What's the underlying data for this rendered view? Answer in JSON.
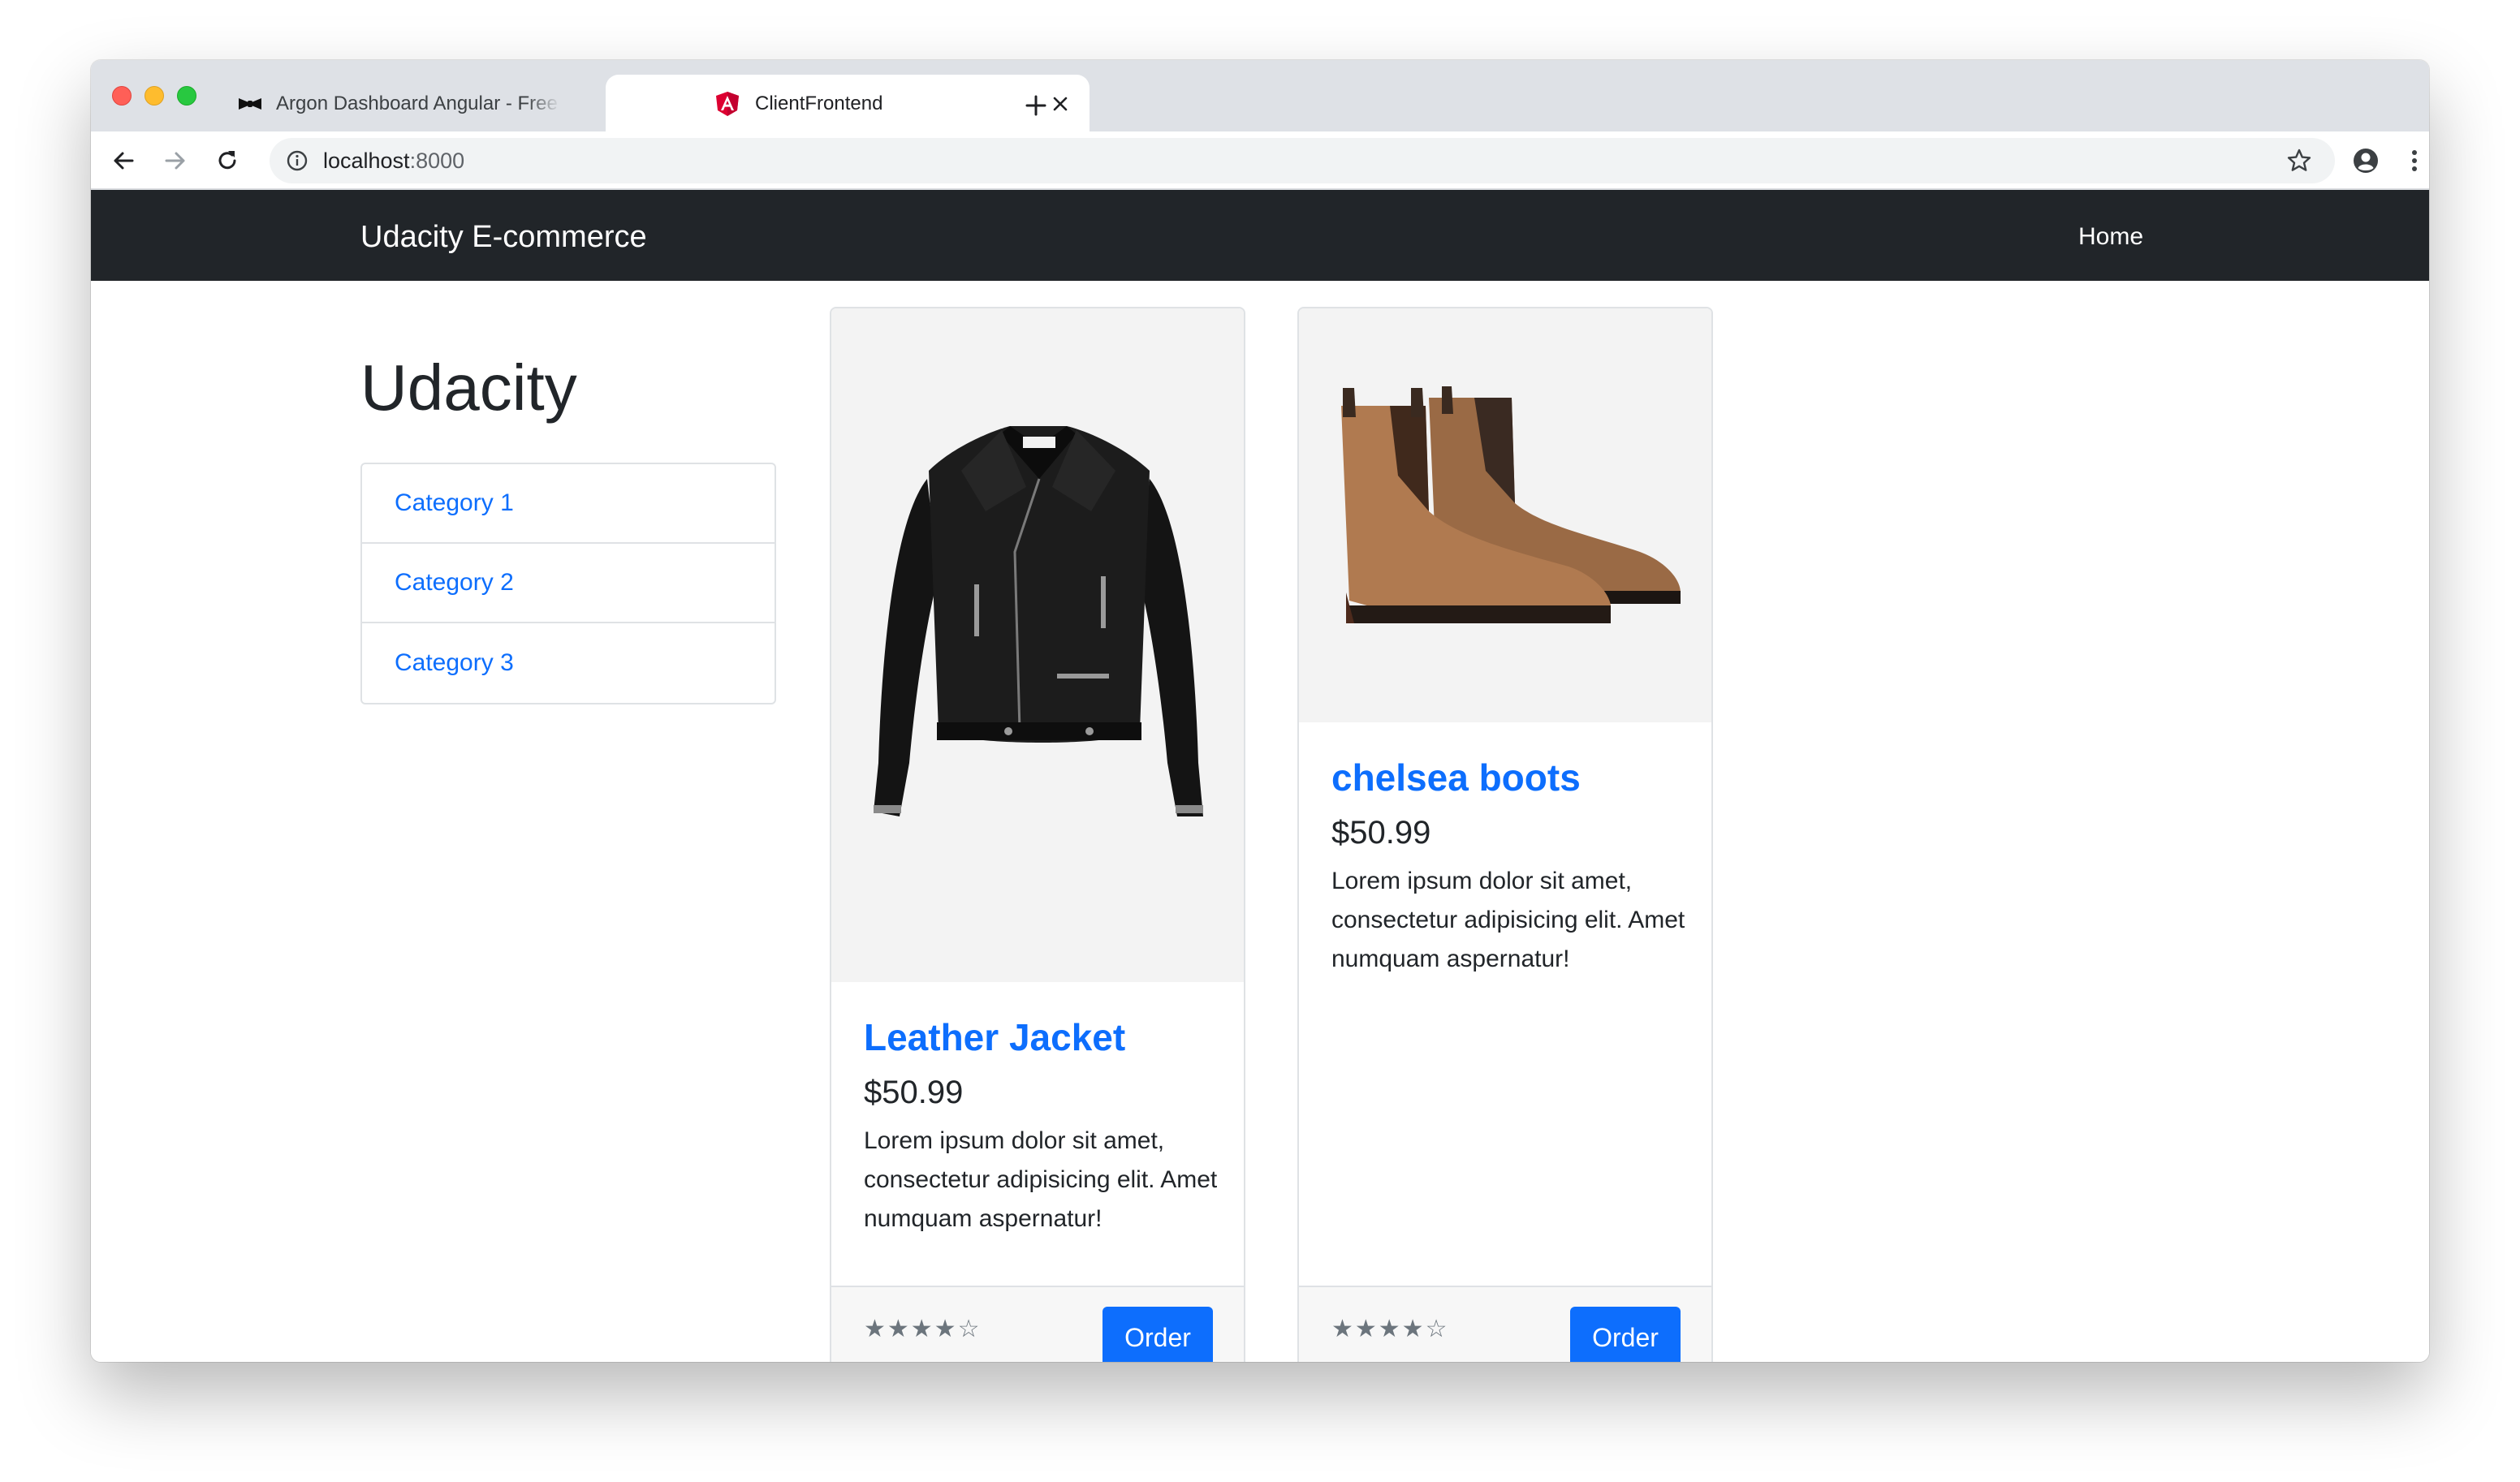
{
  "browser": {
    "tabs": [
      {
        "title": "Argon Dashboard Angular - Free",
        "favicon": "bowtie-icon",
        "active": false
      },
      {
        "title": "ClientFrontend",
        "favicon": "angular-logo-icon",
        "active": true
      }
    ],
    "url": {
      "host": "localhost",
      "port": ":8000"
    }
  },
  "navbar": {
    "brand": "Udacity E-commerce",
    "home": "Home"
  },
  "sidebar": {
    "heading": "Udacity",
    "categories": [
      "Category 1",
      "Category 2",
      "Category 3"
    ]
  },
  "products": [
    {
      "title": "Leather Jacket",
      "price": "$50.99",
      "description": "Lorem ipsum dolor sit amet, consectetur adipisicing elit. Amet numquam aspernatur!",
      "rating": "★★★★☆",
      "order_label": "Order",
      "image": "leather-jacket-image"
    },
    {
      "title": "chelsea boots",
      "price": "$50.99",
      "description": "Lorem ipsum dolor sit amet, consectetur adipisicing elit. Amet numquam aspernatur!",
      "rating": "★★★★☆",
      "order_label": "Order",
      "image": "chelsea-boots-image"
    }
  ],
  "colors": {
    "navbar": "#212529",
    "link": "#0d6efd",
    "button": "#0d6efd"
  }
}
